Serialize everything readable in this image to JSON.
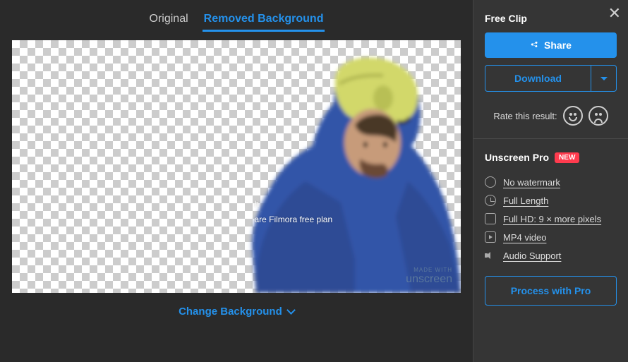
{
  "tabs": {
    "original": "Original",
    "removed": "Removed Background"
  },
  "overlay": {
    "line1": "h",
    "line2": "are Filmora free plan"
  },
  "watermark": {
    "made": "MADE WITH",
    "brand": "unscreen"
  },
  "change_bg": "Change Background",
  "sidebar": {
    "free_clip": "Free Clip",
    "share": "Share",
    "download": "Download",
    "rate_label": "Rate this result:",
    "pro_title": "Unscreen Pro",
    "badge_new": "NEW",
    "features": [
      "No watermark",
      "Full Length",
      "Full HD: 9 × more pixels",
      "MP4 video",
      "Audio Support"
    ],
    "process": "Process with Pro"
  }
}
